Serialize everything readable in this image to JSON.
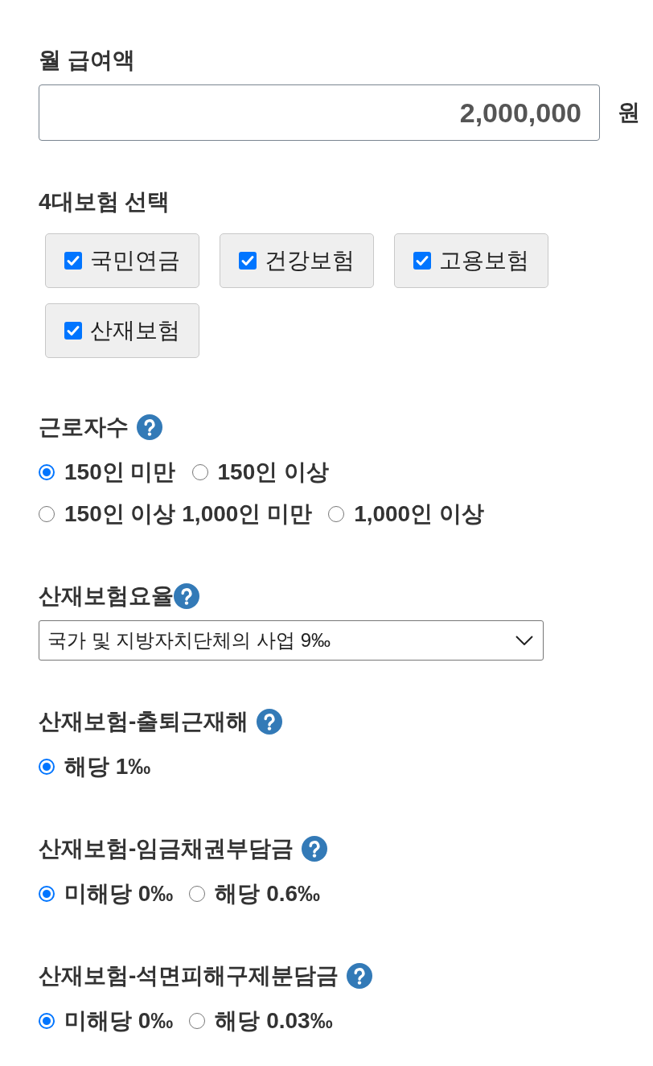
{
  "salary": {
    "label": "월 급여액",
    "value": "2,000,000",
    "unit": "원"
  },
  "insurance": {
    "label": "4대보험 선택",
    "options": [
      {
        "label": "국민연금",
        "checked": true
      },
      {
        "label": "건강보험",
        "checked": true
      },
      {
        "label": "고용보험",
        "checked": true
      },
      {
        "label": "산재보험",
        "checked": true
      }
    ]
  },
  "fields": [
    {
      "kind": "radio",
      "label": "근로자수",
      "options": [
        {
          "label": "150인 미만",
          "selected": true
        },
        {
          "label": "150인 이상",
          "selected": false
        },
        {
          "label": "150인 이상 1,000인 미만",
          "selected": false
        },
        {
          "label": "1,000인 이상",
          "selected": false
        }
      ]
    },
    {
      "kind": "select",
      "label": "산재보험요율",
      "value": "국가 및 지방자치단체의 사업 9‰"
    },
    {
      "kind": "radio",
      "label": "산재보험-출퇴근재해",
      "options": [
        {
          "label": "해당 1‰",
          "selected": true
        }
      ]
    },
    {
      "kind": "radio",
      "label": "산재보험-임금채권부담금",
      "options": [
        {
          "label": "미해당 0‰",
          "selected": true
        },
        {
          "label": "해당 0.6‰",
          "selected": false
        }
      ]
    },
    {
      "kind": "radio",
      "label": "산재보험-석면피해구제분담금",
      "options": [
        {
          "label": "미해당 0‰",
          "selected": true
        },
        {
          "label": "해당 0.03‰",
          "selected": false
        }
      ]
    }
  ]
}
